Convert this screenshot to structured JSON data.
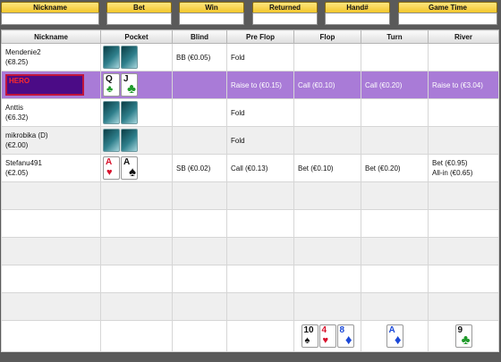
{
  "filters": [
    {
      "label": "Nickname"
    },
    {
      "label": "Bet"
    },
    {
      "label": "Win"
    },
    {
      "label": "Returned"
    },
    {
      "label": "Hand#"
    },
    {
      "label": "Game Time"
    }
  ],
  "columns": [
    "Nickname",
    "Pocket",
    "Blind",
    "Pre Flop",
    "Flop",
    "Turn",
    "River"
  ],
  "players": [
    {
      "name": "Mendenie2",
      "stack": "(€8.25)",
      "blind": "BB (€0.05)",
      "preflop": "Fold",
      "flop": "",
      "turn": "",
      "river": ""
    },
    {
      "name": "HERO",
      "stack": "",
      "blind": "",
      "preflop": "Raise to (€0.15)",
      "flop": "Call (€0.10)",
      "turn": "Call (€0.20)",
      "river": "Raise to (€3.04)",
      "cards": [
        {
          "rank": "Q",
          "suit": "♣"
        },
        {
          "rank": "J",
          "suit": "♣"
        }
      ]
    },
    {
      "name": "Anttis",
      "stack": "(€6.32)",
      "blind": "",
      "preflop": "Fold",
      "flop": "",
      "turn": "",
      "river": ""
    },
    {
      "name": "mikrobika (D)",
      "stack": "(€2.00)",
      "blind": "",
      "preflop": "Fold",
      "flop": "",
      "turn": "",
      "river": ""
    },
    {
      "name": "Stefanu491",
      "stack": "(€2.05)",
      "blind": "SB (€0.02)",
      "preflop": "Call (€0.13)",
      "flop": "Bet (€0.10)",
      "turn": "Bet (€0.20)",
      "river": "Bet (€0.95)",
      "river2": "All-in (€0.65)",
      "cards": [
        {
          "rank": "A",
          "suit": "♥"
        },
        {
          "rank": "A",
          "suit": "♠"
        }
      ]
    }
  ],
  "board": {
    "flop": [
      {
        "rank": "10",
        "suit": "♠"
      },
      {
        "rank": "4",
        "suit": "♥"
      },
      {
        "rank": "8",
        "suit": "♦"
      }
    ],
    "turn": [
      {
        "rank": "A",
        "suit": "♦"
      }
    ],
    "river": [
      {
        "rank": "9",
        "suit": "♣"
      }
    ]
  },
  "colors": {
    "accent": "#f2c62a",
    "hero_row": "#a97bd7",
    "hero_box": "#4b0b86"
  }
}
